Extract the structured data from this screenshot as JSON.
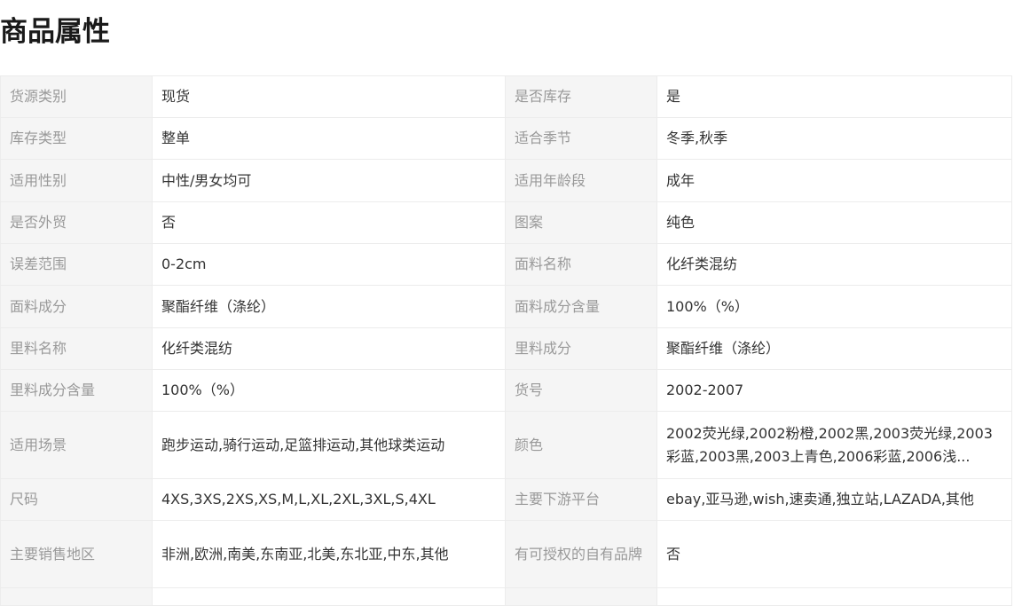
{
  "section": {
    "title": "商品属性"
  },
  "rows": [
    {
      "k1": "货源类别",
      "v1": "现货",
      "k2": "是否库存",
      "v2": "是"
    },
    {
      "k1": "库存类型",
      "v1": "整单",
      "k2": "适合季节",
      "v2": "冬季,秋季"
    },
    {
      "k1": "适用性别",
      "v1": "中性/男女均可",
      "k2": "适用年龄段",
      "v2": "成年"
    },
    {
      "k1": "是否外贸",
      "v1": "否",
      "k2": "图案",
      "v2": "纯色"
    },
    {
      "k1": "误差范围",
      "v1": "0-2cm",
      "k2": "面料名称",
      "v2": "化纤类混纺"
    },
    {
      "k1": "面料成分",
      "v1": "聚酯纤维（涤纶）",
      "k2": "面料成分含量",
      "v2": "100%（%）"
    },
    {
      "k1": "里料名称",
      "v1": "化纤类混纺",
      "k2": "里料成分",
      "v2": "聚酯纤维（涤纶）"
    },
    {
      "k1": "里料成分含量",
      "v1": "100%（%）",
      "k2": "货号",
      "v2": "2002-2007"
    },
    {
      "k1": "适用场景",
      "v1": "跑步运动,骑行运动,足篮排运动,其他球类运动",
      "k2": "颜色",
      "v2": "2002荧光绿,2002粉橙,2002黑,2003荧光绿,2003彩蓝,2003黑,2003上青色,2006彩蓝,2006浅..."
    },
    {
      "k1": "尺码",
      "v1": "4XS,3XS,2XS,XS,M,L,XL,2XL,3XL,S,4XL",
      "k2": "主要下游平台",
      "v2": "ebay,亚马逊,wish,速卖通,独立站,LAZADA,其他"
    },
    {
      "k1": "主要销售地区",
      "v1": "非洲,欧洲,南美,东南亚,北美,东北亚,中东,其他",
      "k2": "有可授权的自有品牌",
      "v2": "否"
    }
  ]
}
